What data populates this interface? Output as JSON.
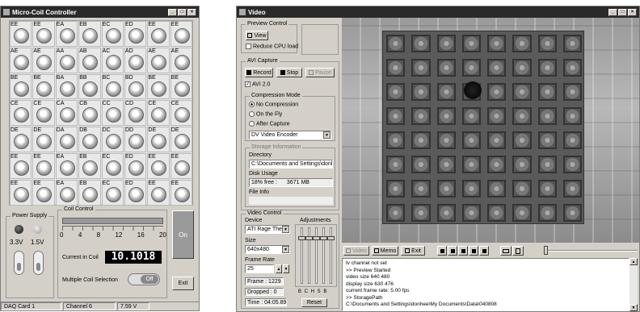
{
  "micro": {
    "title": "Micro-Coil Controller",
    "coil_labels": [
      [
        "EE",
        "EE",
        "EA",
        "EB",
        "EC",
        "ED",
        "EE",
        "EE"
      ],
      [
        "AE",
        "AE",
        "AA",
        "AB",
        "AC",
        "AD",
        "AE",
        "AE"
      ],
      [
        "BE",
        "BE",
        "BA",
        "BB",
        "BC",
        "BD",
        "BE",
        "BE"
      ],
      [
        "CE",
        "CE",
        "CA",
        "CB",
        "CC",
        "CD",
        "CE",
        "CE"
      ],
      [
        "DE",
        "DE",
        "DA",
        "DB",
        "DC",
        "DD",
        "DE",
        "DE"
      ],
      [
        "EE",
        "EE",
        "EA",
        "EB",
        "EC",
        "ED",
        "EE",
        "EE"
      ],
      [
        "EE",
        "EE",
        "EA",
        "EB",
        "EC",
        "ED",
        "EE",
        "EE"
      ]
    ],
    "power_supply_label": "Power Supply",
    "v1": "3.3V",
    "v2": "1.5V",
    "coil_control_label": "Coil Control",
    "scale": [
      "0",
      "4",
      "8",
      "12",
      "16",
      "20"
    ],
    "current_label": "Current in Coil",
    "current_value": "10.1018",
    "on_button": "On",
    "multi_label": "Multiple Coil Selection",
    "off_toggle": "Off",
    "exit_button": "Exit",
    "status": [
      "DAQ Card 1",
      "Channel 6",
      "7.59 V"
    ]
  },
  "video": {
    "title": "Video",
    "preview_group": "Preview Control",
    "view_button": "View",
    "reduce_cpu": "Reduce CPU load",
    "avi_group": "AVI Capture",
    "record": "Record",
    "stop": "Stop",
    "pause": "Pause",
    "avi2": "AVI 2.0",
    "comp_group": "Compression Mode",
    "comp_opts": [
      "No Compression",
      "On the Fly",
      "After Capture"
    ],
    "encoder": "DV Video Encoder",
    "storage_group": "Storage Information",
    "directory_label": "Directory",
    "directory_value": "C:\\Documents and Settings\\donhe",
    "disk_label": "Disk Usage",
    "disk_free": "18% free :",
    "disk_mb": "3671 MB",
    "file_info": "File Info",
    "vc_group": "Video Control",
    "device_label": "Device",
    "device_value": "ATI Rage The",
    "adjust_label": "Adjustments",
    "size_label": "Size",
    "size_value": "640x480",
    "fr_label": "Frame Rate",
    "fr_value": "25",
    "frame": "Frame : 1229",
    "dropped": "Dropped : 0",
    "time": "Time : 04:05.89",
    "adj_letters": "B  C  H  S  B",
    "reset": "Reset",
    "tb_video": "Video",
    "tb_memo": "Memo",
    "tb_exit": "Exit",
    "log": [
      "tv channel not set",
      ">> Preview Started",
      "video size 640 480",
      "display size 630 476",
      "current frame rate: 5.00 fps",
      ">> StoragePath",
      "C:\\Documents and Settings\\donhee\\My Documents\\Data\\040808"
    ],
    "scrollbar_btns": [
      "▲",
      "▼"
    ]
  }
}
